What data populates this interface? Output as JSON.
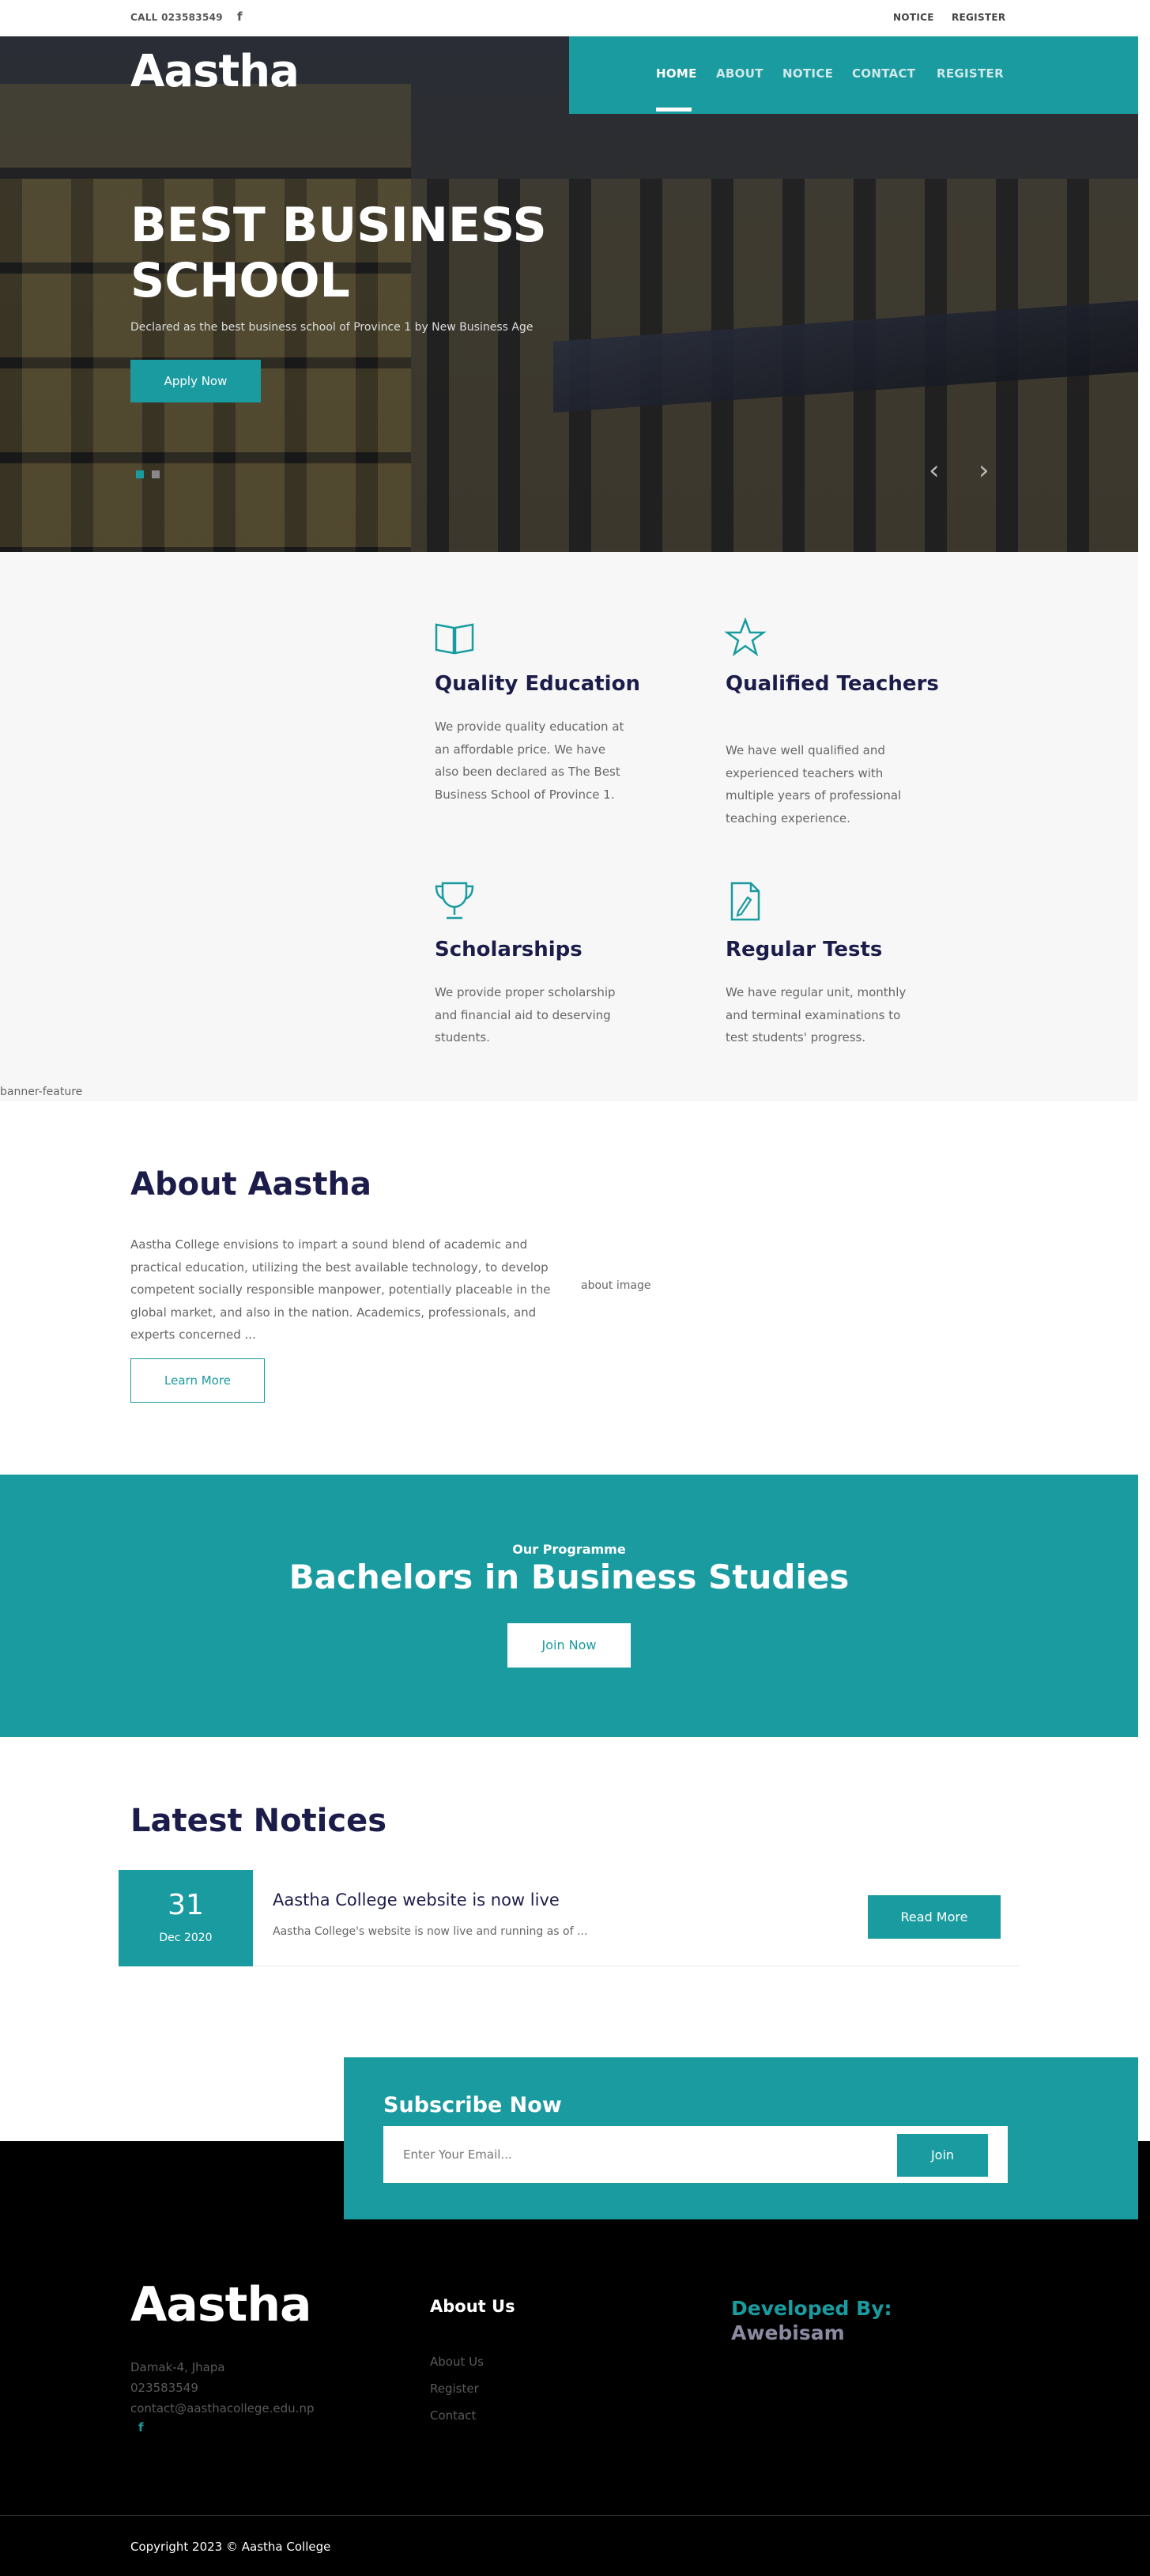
{
  "topbar": {
    "call": "CALL 023583549",
    "facebook_icon": "facebook-icon",
    "links": [
      "NOTICE",
      "REGISTER"
    ]
  },
  "header": {
    "logo": "Aastha",
    "nav": [
      "HOME",
      "ABOUT",
      "NOTICE",
      "CONTACT",
      "REGISTER"
    ],
    "active_nav": "HOME"
  },
  "hero": {
    "title": "BEST BUSINESS SCHOOL",
    "subtitle": "Declared as the best business school of Province 1 by New Business Age",
    "button": "Apply Now",
    "prev_icon": "chevron-left-icon",
    "next_icon": "chevron-right-icon"
  },
  "features": [
    {
      "icon": "book-icon",
      "title": "Quality Education",
      "text": "We provide quality education at an affordable price. We have also been declared as The Best Business School of Province 1."
    },
    {
      "icon": "star-icon",
      "title": "Qualified Teachers",
      "text": "We have well qualified and experienced teachers with multiple years of professional teaching experience."
    },
    {
      "icon": "trophy-icon",
      "title": "Scholarships",
      "text": "We provide proper scholarship and financial aid to deserving students."
    },
    {
      "icon": "document-pencil-icon",
      "title": "Regular Tests",
      "text": "We have regular unit, monthly and terminal examinations to test students' progress."
    }
  ],
  "banner_feature_alt": "banner-feature",
  "about": {
    "title": "About Aastha",
    "text": "Aastha College envisions to impart a sound blend of academic and practical education, utilizing the best available technology, to develop competent socially responsible manpower, potentially placeable in the global market, and also in the nation. Academics, professionals, and experts concerned ...",
    "button": "Learn More",
    "image_alt": "about image"
  },
  "programme": {
    "kicker": "Our Programme",
    "title": "Bachelors in Business Studies",
    "button": "Join Now"
  },
  "notices": {
    "title": "Latest Notices",
    "items": [
      {
        "day": "31",
        "month": "Dec 2020",
        "title": "Aastha College website is now live",
        "excerpt": "Aastha College's website is now live and running as of ...",
        "button": "Read More"
      }
    ]
  },
  "subscribe": {
    "title": "Subscribe Now",
    "placeholder": "Enter Your Email...",
    "button": "Join"
  },
  "footer": {
    "logo": "Aastha",
    "address": "Damak-4, Jhapa",
    "phone": "023583549",
    "email": "contact@aasthacollege.edu.np",
    "about_heading": "About Us",
    "links": [
      "About Us",
      "Register",
      "Contact"
    ],
    "developed_by_label": "Developed By:",
    "developer": "Awebisam",
    "copyright": "Copyright 2023 © Aastha College"
  },
  "colors": {
    "accent": "#1a9ba0",
    "heading": "#1c1c4a",
    "footer_bg": "#000000"
  }
}
